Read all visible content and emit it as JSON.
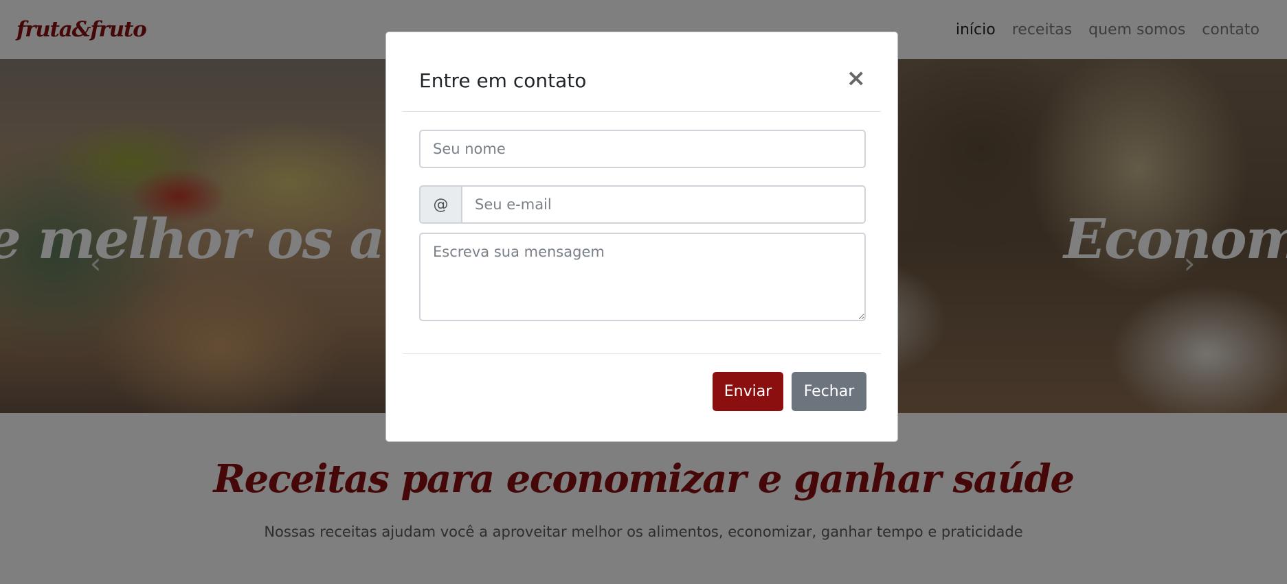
{
  "navbar": {
    "brand": "fruta&fruto",
    "links": [
      {
        "label": "início",
        "active": true
      },
      {
        "label": "receitas",
        "active": false
      },
      {
        "label": "quem somos",
        "active": false
      },
      {
        "label": "contato",
        "active": false
      }
    ]
  },
  "carousel": {
    "slides": [
      {
        "caption": "e melhor os alim"
      },
      {
        "caption": "Economiz"
      }
    ],
    "prev_icon": "chevron-left-icon",
    "next_icon": "chevron-right-icon"
  },
  "section": {
    "title": "Receitas para economizar e ganhar saúde",
    "subtitle": "Nossas receitas ajudam você a aproveitar melhor os alimentos, economizar, ganhar tempo e praticidade"
  },
  "modal": {
    "title": "Entre em contato",
    "close_icon": "close-icon",
    "name_placeholder": "Seu nome",
    "email_addon": "@",
    "email_placeholder": "Seu e-mail",
    "message_placeholder": "Escreva sua mensagem",
    "send_label": "Enviar",
    "close_label": "Fechar"
  },
  "colors": {
    "brand": "#8b0f0f",
    "secondary": "#6c757d"
  }
}
